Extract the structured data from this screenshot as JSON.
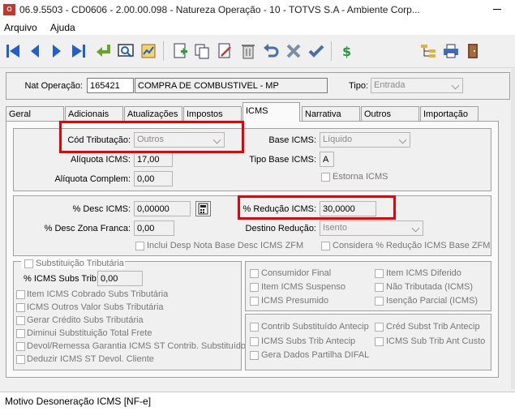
{
  "window": {
    "title": "06.9.5503 - CD0606 - 2.00.00.098 - Natureza Operação - 10 - TOTVS S.A - Ambiente Corp...",
    "app_icon_text": "O"
  },
  "menu": {
    "items": [
      "Arquivo",
      "Ajuda"
    ]
  },
  "header": {
    "nat_operacao_label": "Nat Operação:",
    "nat_operacao_code": "165421",
    "nat_operacao_desc": "COMPRA DE COMBUSTIVEL - MP",
    "tipo_label": "Tipo:",
    "tipo_value": "Entrada"
  },
  "tabs": [
    "Geral",
    "Adicionais",
    "Atualizações",
    "Impostos",
    "ICMS",
    "Narrativa",
    "Outros",
    "Importação"
  ],
  "active_tab": "ICMS",
  "icms": {
    "cod_tributacao_label": "Cód Tributação:",
    "cod_tributacao_value": "Outros",
    "base_icms_label": "Base ICMS:",
    "base_icms_value": "Líquido",
    "aliquota_icms_label": "Alíquota ICMS:",
    "aliquota_icms_value": "17,00",
    "tipo_base_icms_label": "Tipo Base ICMS:",
    "tipo_base_icms_value": "A",
    "aliquota_complem_label": "Alíquota Complem:",
    "aliquota_complem_value": "0,00",
    "estorna_icms_label": "Estorna ICMS",
    "desc_icms_label": "% Desc ICMS:",
    "desc_icms_value": "0,00000",
    "reducao_icms_label": "% Redução ICMS:",
    "reducao_icms_value": "30,0000",
    "desc_zona_franca_label": "% Desc Zona Franca:",
    "desc_zona_franca_value": "0,00",
    "destino_reducao_label": "Destino Redução:",
    "destino_reducao_value": "Isento",
    "inclui_desp_label": "Inclui Desp Nota Base Desc ICMS ZFM",
    "considera_reducao_label": "Considera % Redução ICMS Base ZFM"
  },
  "subst": {
    "group_label": "Substituição Tributária",
    "icms_subs_trib_label": "% ICMS Subs Trib:",
    "icms_subs_trib_value": "0,00",
    "options": [
      "Item ICMS Cobrado Subs Tributária",
      "ICMS Outros Valor Subs Tributária",
      "Gerar Crédito Subs Tributária",
      "Diminui Substituição Total Frete",
      "Devol/Remessa Garantia ICMS ST Contrib. Substituído",
      "Deduzir ICMS ST Devol. Cliente"
    ]
  },
  "flags_left": [
    "Consumidor Final",
    "Item ICMS Suspenso",
    "ICMS Presumido"
  ],
  "flags_right": [
    "Item ICMS Diferido",
    "Não Tributada (ICMS)",
    "Isenção Parcial (ICMS)"
  ],
  "contrib_left": [
    "Contrib Substituído Antecip",
    "ICMS Subs Trib Antecip",
    "Gera Dados Partilha DIFAL"
  ],
  "contrib_right": [
    "Créd Subst Trib Antecip",
    "ICMS Sub Trib Ant Custo"
  ],
  "status": {
    "text": "Motivo Desoneração ICMS [NF-e]"
  },
  "colors": {
    "highlight": "#e00000",
    "disabled_text": "#8a8a8a"
  }
}
